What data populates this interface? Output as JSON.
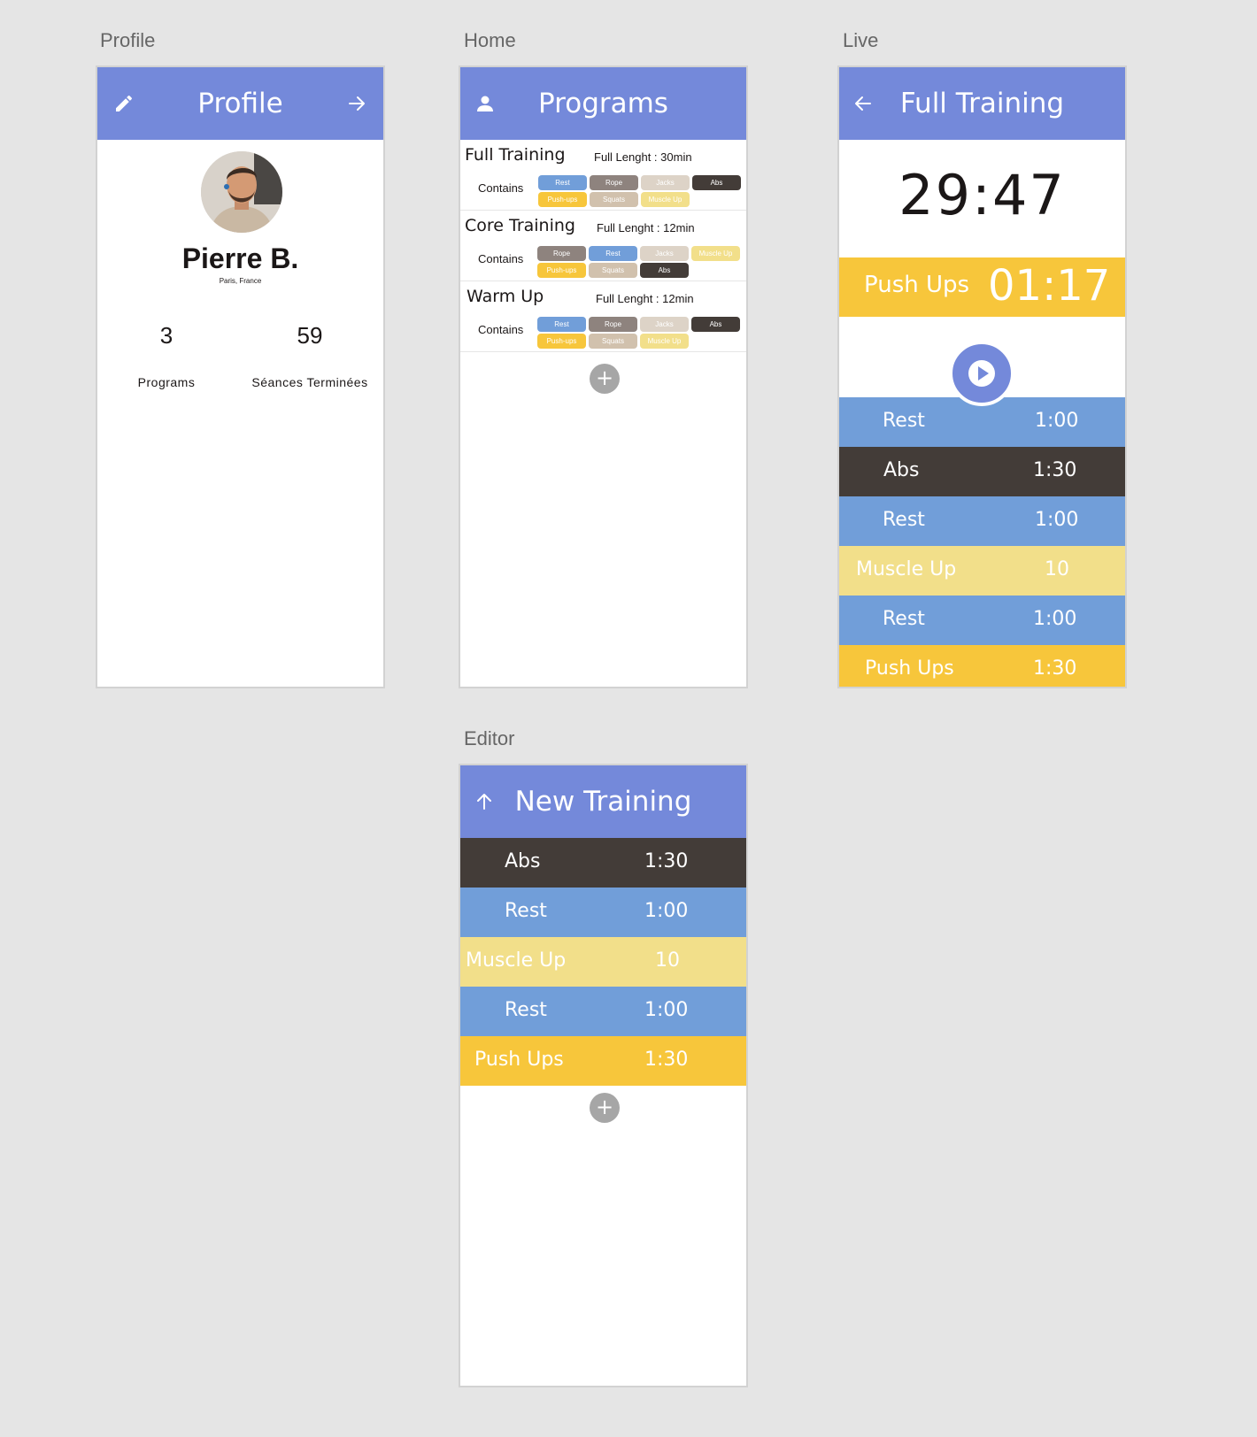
{
  "artboards": {
    "profile": "Profile",
    "home": "Home",
    "live": "Live",
    "editor": "Editor"
  },
  "colors": {
    "header": "#7489da",
    "rest": "#719ed9",
    "abs": "#433c38",
    "muscle_up": "#f2df8a",
    "push_ups": "#f7c63b",
    "rope": "#8e837e",
    "jacks": "#ddd3c7",
    "squats": "#d1c1ad",
    "add_button": "#a6a6a6"
  },
  "profile": {
    "header_title": "Profile",
    "left_icon": "pencil-icon",
    "right_icon": "arrow-right-icon",
    "name": "Pierre B.",
    "location": "Paris, France",
    "stats": [
      {
        "value": "3",
        "label": "Programs"
      },
      {
        "value": "59",
        "label": "Séances Terminées"
      }
    ]
  },
  "home": {
    "header_title": "Programs",
    "left_icon": "user-icon",
    "contains_label": "Contains",
    "programs": [
      {
        "name": "Full Training",
        "length": "Full Lenght : 30min",
        "tags": [
          "Rest",
          "Rope",
          "Jacks",
          "Abs",
          "Push-ups",
          "Squats",
          "Muscle Up"
        ]
      },
      {
        "name": "Core Training",
        "length": "Full Lenght : 12min",
        "tags": [
          "Rope",
          "Rest",
          "Jacks",
          "Muscle Up",
          "Push-ups",
          "Squats",
          "Abs"
        ]
      },
      {
        "name": "Warm Up",
        "length": "Full Lenght : 12min",
        "tags": [
          "Rest",
          "Rope",
          "Jacks",
          "Abs",
          "Push-ups",
          "Squats",
          "Muscle Up"
        ]
      }
    ],
    "add_symbol": "+"
  },
  "live": {
    "header_title": "Full Training",
    "left_icon": "arrow-left-icon",
    "total_timer": "29:47",
    "current_exercise": "Push Ups",
    "current_timer": "01:17",
    "play_icon": "play-icon",
    "queue": [
      {
        "name": "Rest",
        "value": "1:00"
      },
      {
        "name": "Abs",
        "value": "1:30"
      },
      {
        "name": "Rest",
        "value": "1:00"
      },
      {
        "name": "Muscle Up",
        "value": "10"
      },
      {
        "name": "Rest",
        "value": "1:00"
      },
      {
        "name": "Push Ups",
        "value": "1:30"
      }
    ]
  },
  "editor": {
    "header_title": "New Training",
    "left_icon": "arrow-up-icon",
    "rows": [
      {
        "name": "Abs",
        "value": "1:30"
      },
      {
        "name": "Rest",
        "value": "1:00"
      },
      {
        "name": "Muscle Up",
        "value": "10"
      },
      {
        "name": "Rest",
        "value": "1:00"
      },
      {
        "name": "Push Ups",
        "value": "1:30"
      }
    ],
    "add_symbol": "+"
  }
}
